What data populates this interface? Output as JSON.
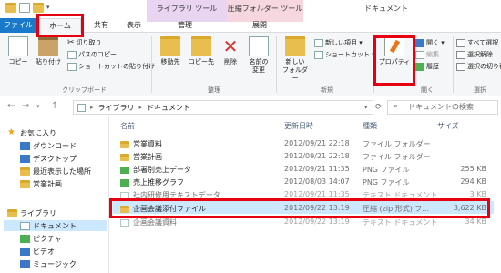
{
  "window": {
    "title": "ドキュメント"
  },
  "context_tabs": {
    "library_tools": "ライブラリ ツール",
    "compressed_tools": "圧縮フォルダー ツール"
  },
  "tabs": {
    "file": "ファイル",
    "home": "ホーム",
    "share": "共有",
    "view": "表示",
    "manage": "管理",
    "extract": "展開"
  },
  "ribbon": {
    "clipboard": {
      "copy": "コピー",
      "paste": "貼り付け",
      "cut": "切り取り",
      "copy_path": "パスのコピー",
      "paste_shortcut": "ショートカットの貼り付け",
      "label": "クリップボード"
    },
    "organize": {
      "move_to": "移動先",
      "copy_to": "コピー先",
      "delete": "削除",
      "rename_1": "名前の",
      "rename_2": "変更",
      "label": "整理"
    },
    "new": {
      "new_folder_1": "新しい",
      "new_folder_2": "フォルダー",
      "new_item": "新しい項目 ▾",
      "shortcut": "ショートカット ▾",
      "label": "新規"
    },
    "open": {
      "properties": "プロパティ",
      "open": "開く ▾",
      "edit": "編集",
      "history": "履歴",
      "label": "開く"
    },
    "select": {
      "select_all": "すべて選択",
      "select_none": "選択解除",
      "invert": "選択の切り替え",
      "label": "選択"
    }
  },
  "address": {
    "path_1": "ライブラリ",
    "path_2": "ドキュメント",
    "search_placeholder": "ドキュメントの検索"
  },
  "nav": {
    "favorites": "お気に入り",
    "downloads": "ダウンロード",
    "desktop": "デスクトップ",
    "recent": "最近表示した場所",
    "sales_plan": "営業計画",
    "libraries": "ライブラリ",
    "documents": "ドキュメント",
    "pictures": "ピクチャ",
    "videos": "ビデオ",
    "music": "ミュージック"
  },
  "columns": {
    "name": "名前",
    "date": "更新日時",
    "type": "種類",
    "size": "サイズ"
  },
  "files": [
    {
      "name": "営業資料",
      "date": "2012/09/21 22:18",
      "type": "ファイル フォルダー",
      "size": ""
    },
    {
      "name": "営業計画",
      "date": "2012/09/21 22:18",
      "type": "ファイル フォルダー",
      "size": ""
    },
    {
      "name": "部署別売上データ",
      "date": "2012/09/21 11:35",
      "type": "PNG ファイル",
      "size": "255 KB"
    },
    {
      "name": "売上推移グラフ",
      "date": "2012/08/03 14:07",
      "type": "PNG ファイル",
      "size": "294 KB"
    },
    {
      "name": "社内研修用テキストデータ",
      "date": "2012/09/21 11:35",
      "type": "テキスト ドキュメント",
      "size": "3 KB"
    },
    {
      "name": "企画会議添付ファイル",
      "date": "2012/09/22 13:19",
      "type": "圧縮 (zip 形式) フ...",
      "size": "3,622 KB"
    },
    {
      "name": "企画会議資料",
      "date": "2012/09/22 13:19",
      "type": "テキスト ドキュメント",
      "size": "34 KB"
    }
  ],
  "colors": {
    "file_tab": "#1979ca",
    "highlight": "#e60012",
    "selection": "#cce8ff",
    "folder": "#e8bf4e",
    "library_ctx": "#e9d5f1",
    "zip_ctx": "#f6d7df"
  }
}
